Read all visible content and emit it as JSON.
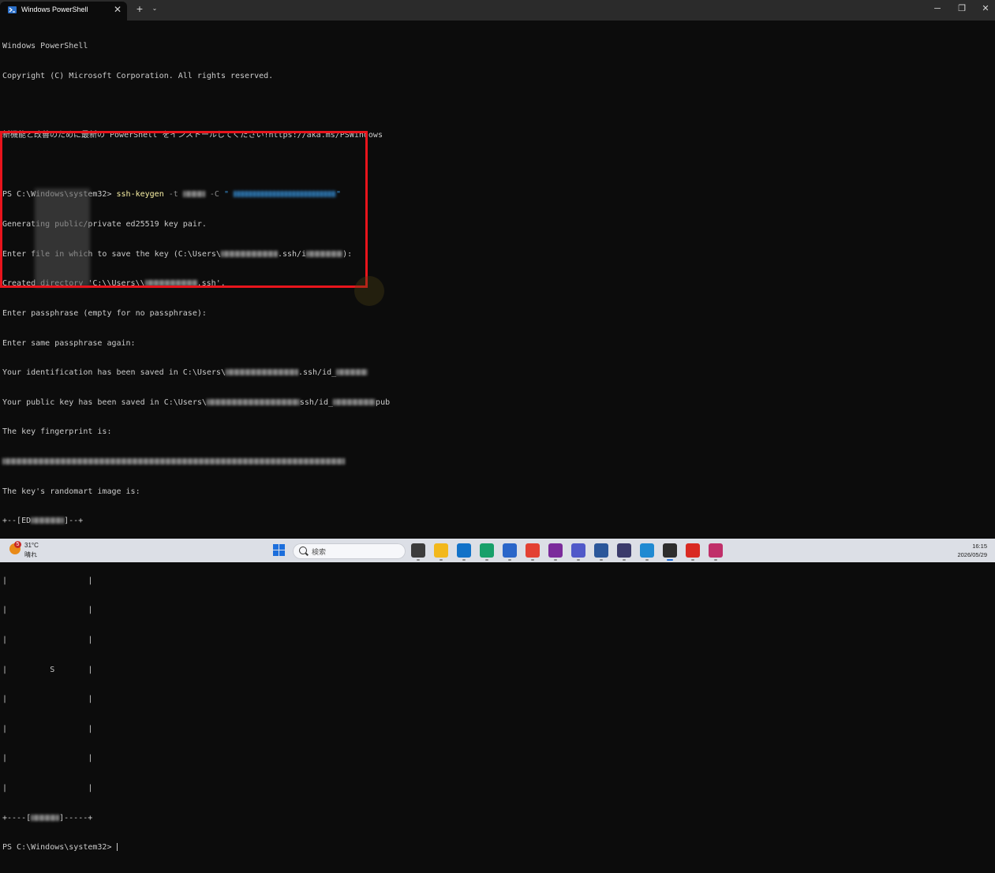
{
  "window": {
    "tab_title": "Windows PowerShell",
    "close_tab_symbol": "✕",
    "new_tab_symbol": "+",
    "dropdown_symbol": "⌄",
    "minimize_symbol": "─",
    "maximize_symbol": "❐",
    "close_symbol": "✕"
  },
  "terminal": {
    "banner_1": "Windows PowerShell",
    "banner_2": "Copyright (C) Microsoft Corporation. All rights reserved.",
    "banner_3": "新機能と改善のために最新の PowerShell をインストールしてください!https://aka.ms/PSWindows",
    "prompt": "PS C:\\Windows\\system32>",
    "command": "ssh-keygen",
    "flag_t": "-t",
    "flag_c": "-C",
    "quote": "\"",
    "line_generating": "Generating public/private ed25519 key pair.",
    "line_enter_file_prefix": "Enter file in which to save the key (C:\\Users\\",
    "line_enter_file_mid": ".ssh/i",
    "line_enter_file_suffix": "):",
    "line_created_prefix": "Created directory 'C:\\\\Users\\\\",
    "line_created_suffix": ".ssh'.",
    "line_passphrase": "Enter passphrase (empty for no passphrase):",
    "line_passphrase_again": "Enter same passphrase again:",
    "line_ident_prefix": "Your identification has been saved in C:\\Users\\",
    "line_ident_suffix": ".ssh/id_",
    "line_pub_prefix": "Your public key has been saved in C:\\Users\\",
    "line_pub_mid": "ssh/id_",
    "line_pub_suffix": "pub",
    "line_fingerprint": "The key fingerprint is:",
    "line_randomart": "The key's randomart image is:",
    "art_top_left": "+--[ED",
    "art_top_right": "]--+",
    "art_side": "|",
    "art_bottom_left": "+----[",
    "art_bottom_right": "]-----+",
    "art_mid_char": "S",
    "final_prompt": "PS C:\\Windows\\system32>"
  },
  "taskbar": {
    "weather_badge": "5",
    "weather_temp": "31°C",
    "weather_condition": "晴れ",
    "search_placeholder": "検索",
    "clock_time": "16:15",
    "clock_date": "2026/05/29",
    "apps": [
      {
        "name": "task-view",
        "color": "#3c3c3c"
      },
      {
        "name": "file-explorer",
        "color": "#f2b81c"
      },
      {
        "name": "outlook",
        "color": "#1272c8"
      },
      {
        "name": "edge",
        "color": "#18a06a"
      },
      {
        "name": "store",
        "color": "#2a66c9"
      },
      {
        "name": "chrome",
        "color": "#e34133"
      },
      {
        "name": "onenote",
        "color": "#7b2b9b"
      },
      {
        "name": "teams",
        "color": "#5059c9"
      },
      {
        "name": "word",
        "color": "#2b579a"
      },
      {
        "name": "app-msix",
        "color": "#3b3b6b"
      },
      {
        "name": "vscode",
        "color": "#1f8ad2"
      },
      {
        "name": "terminal",
        "color": "#2d2d2d"
      },
      {
        "name": "acrobat",
        "color": "#d92a22"
      },
      {
        "name": "snipping-tool",
        "color": "#c0306a"
      }
    ]
  }
}
